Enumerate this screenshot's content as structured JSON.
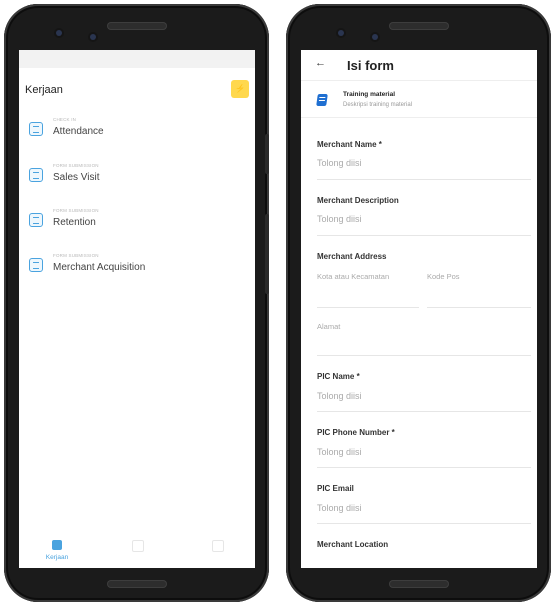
{
  "left_screen": {
    "header": {
      "title": "Kerjaan",
      "badge_icon": "flash-icon",
      "badge_color": "#ffd84d"
    },
    "tasks": [
      {
        "type": "CHECK IN",
        "name": "Attendance",
        "icon": "calendar-check-icon"
      },
      {
        "type": "FORM SUBMISSION",
        "name": "Sales Visit",
        "icon": "form-icon"
      },
      {
        "type": "FORM SUBMISSION",
        "name": "Retention",
        "icon": "form-icon"
      },
      {
        "type": "FORM SUBMISSION",
        "name": "Merchant Acquisition",
        "icon": "form-icon"
      }
    ],
    "bottom_nav": [
      {
        "label": "Kerjaan",
        "active": true
      },
      {
        "label": "",
        "active": false
      },
      {
        "label": "",
        "active": false
      }
    ],
    "accent_color": "#4aa3df"
  },
  "right_screen": {
    "header": {
      "back": "←",
      "title": "Isi form"
    },
    "training": {
      "title": "Training material",
      "description": "Deskripsi training material",
      "icon_color": "#1f6fd1"
    },
    "fields": {
      "merchant_name": {
        "label": "Merchant Name *",
        "placeholder": "Tolong diisi"
      },
      "merchant_description": {
        "label": "Merchant Description",
        "placeholder": "Tolong diisi"
      },
      "merchant_address": {
        "label": "Merchant Address",
        "city_placeholder": "Kota atau Kecamatan",
        "postal_placeholder": "Kode Pos",
        "address_placeholder": "Alamat"
      },
      "pic_name": {
        "label": "PIC Name *",
        "placeholder": "Tolong diisi"
      },
      "pic_phone": {
        "label": "PIC Phone Number *",
        "placeholder": "Tolong diisi"
      },
      "pic_email": {
        "label": "PIC Email",
        "placeholder": "Tolong diisi"
      },
      "merchant_location": {
        "label": "Merchant Location"
      }
    }
  }
}
